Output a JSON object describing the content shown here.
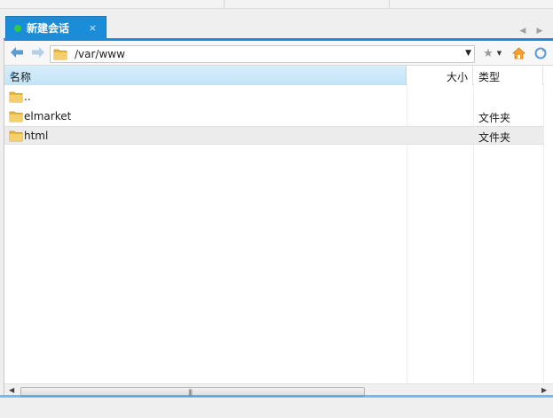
{
  "tab": {
    "title": "新建会话",
    "close": "×",
    "indicator_color": "#2ecc40"
  },
  "toolbar": {
    "path": "/var/www",
    "back_icon": "arrow-left-icon",
    "forward_icon": "arrow-right-icon",
    "bookmark_icon": "star-icon",
    "home_icon": "home-icon",
    "refresh_icon": "refresh-icon"
  },
  "columns": {
    "name": "名称",
    "size": "大小",
    "type": "类型"
  },
  "files": [
    {
      "name": "..",
      "type": ""
    },
    {
      "name": "elmarket",
      "type": "文件夹"
    },
    {
      "name": "html",
      "type": "文件夹"
    }
  ],
  "scrollbar": {
    "grip": "|||"
  },
  "colors": {
    "accent": "#1a8cd8",
    "header": "#c9e8f9",
    "folder": "#e8b73a"
  }
}
